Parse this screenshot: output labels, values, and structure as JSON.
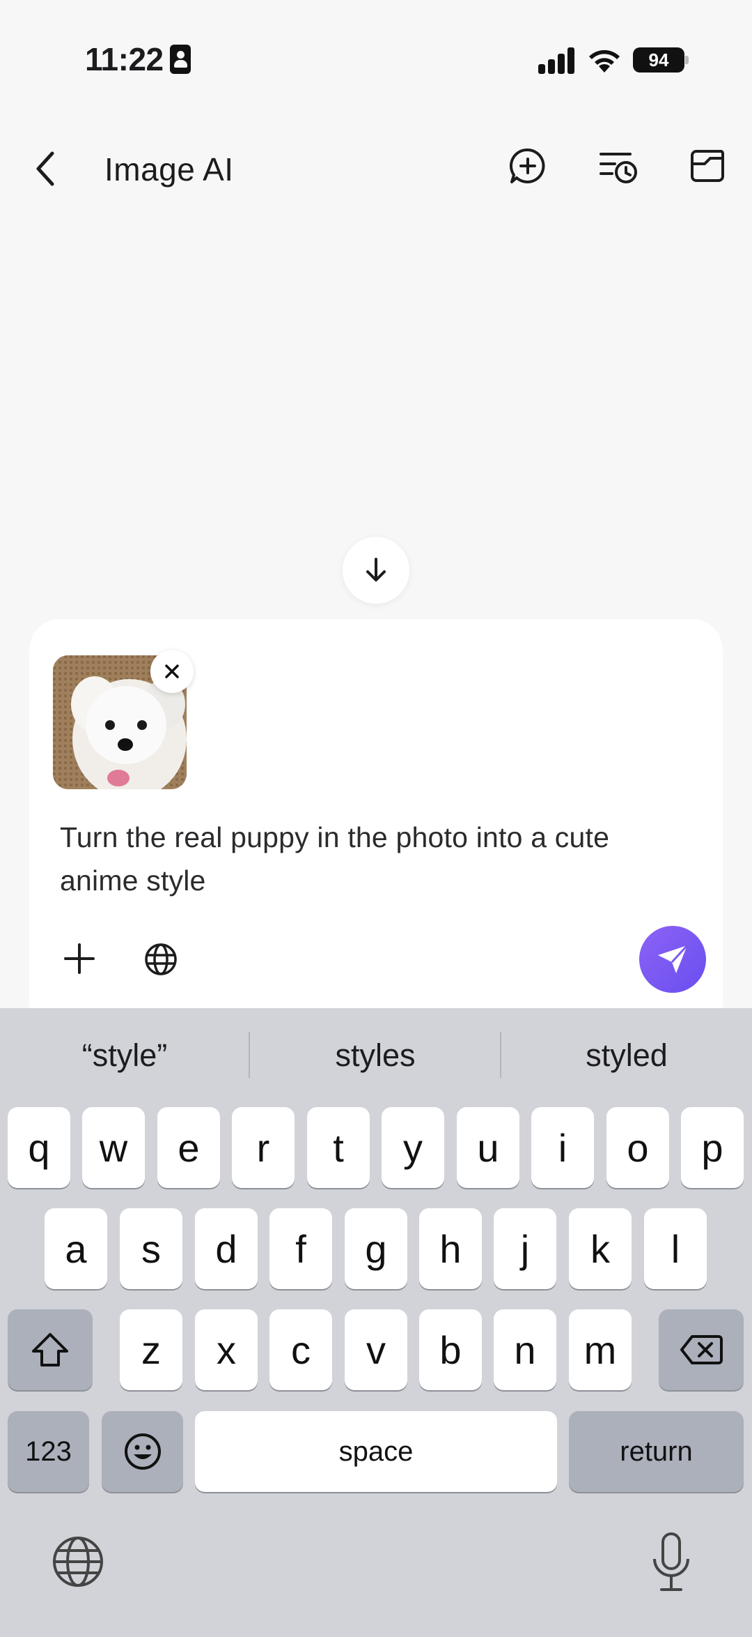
{
  "status_bar": {
    "time": "11:22",
    "battery": "94"
  },
  "header": {
    "title": "Image AI"
  },
  "composer": {
    "prompt_text": "Turn the real puppy in the photo into a cute anime style",
    "send_color": "#7b5af3"
  },
  "keyboard": {
    "suggestions": [
      "“style”",
      "styles",
      "styled"
    ],
    "row1": [
      "q",
      "w",
      "e",
      "r",
      "t",
      "y",
      "u",
      "i",
      "o",
      "p"
    ],
    "row2": [
      "a",
      "s",
      "d",
      "f",
      "g",
      "h",
      "j",
      "k",
      "l"
    ],
    "row3": [
      "z",
      "x",
      "c",
      "v",
      "b",
      "n",
      "m"
    ],
    "numbers_label": "123",
    "space_label": "space",
    "return_label": "return"
  }
}
